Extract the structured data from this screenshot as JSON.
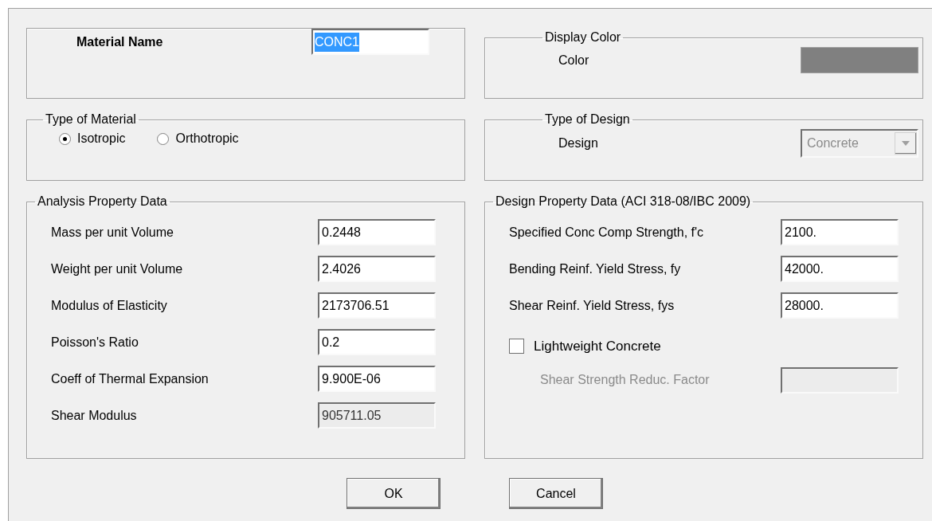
{
  "material_name": {
    "label": "Material Name",
    "value": "CONC1",
    "text_selected": true
  },
  "type_of_material": {
    "title": "Type of Material",
    "options": [
      {
        "label": "Isotropic",
        "selected": true
      },
      {
        "label": "Orthotropic",
        "selected": false
      }
    ]
  },
  "analysis_property_data": {
    "title": "Analysis Property Data",
    "fields": [
      {
        "label": "Mass per unit Volume",
        "value": "0.2448",
        "disabled": false
      },
      {
        "label": "Weight per unit Volume",
        "value": "2.4026",
        "disabled": false
      },
      {
        "label": "Modulus of Elasticity",
        "value": "2173706.51",
        "disabled": false
      },
      {
        "label": "Poisson's Ratio",
        "value": "0.2",
        "disabled": false
      },
      {
        "label": "Coeff of Thermal Expansion",
        "value": "9.900E-06",
        "disabled": false
      },
      {
        "label": "Shear Modulus",
        "value": "905711.05",
        "disabled": true
      }
    ]
  },
  "display_color": {
    "title": "Display Color",
    "label": "Color",
    "color": "#808080"
  },
  "type_of_design": {
    "title": "Type of Design",
    "label": "Design",
    "value": "Concrete",
    "disabled": true
  },
  "design_property_data": {
    "title": "Design Property Data (ACI 318-08/IBC 2009)",
    "fields": [
      {
        "label": "Specified Conc Comp Strength, f'c",
        "value": "2100.",
        "disabled": false
      },
      {
        "label": "Bending Reinf. Yield Stress, fy",
        "value": "42000.",
        "disabled": false
      },
      {
        "label": "Shear Reinf. Yield Stress, fys",
        "value": "28000.",
        "disabled": false
      }
    ],
    "lightweight": {
      "label": "Lightweight Concrete",
      "checked": false
    },
    "reduction_factor": {
      "label": "Shear Strength Reduc. Factor",
      "disabled": true
    }
  },
  "buttons": [
    "OK",
    "Cancel"
  ]
}
